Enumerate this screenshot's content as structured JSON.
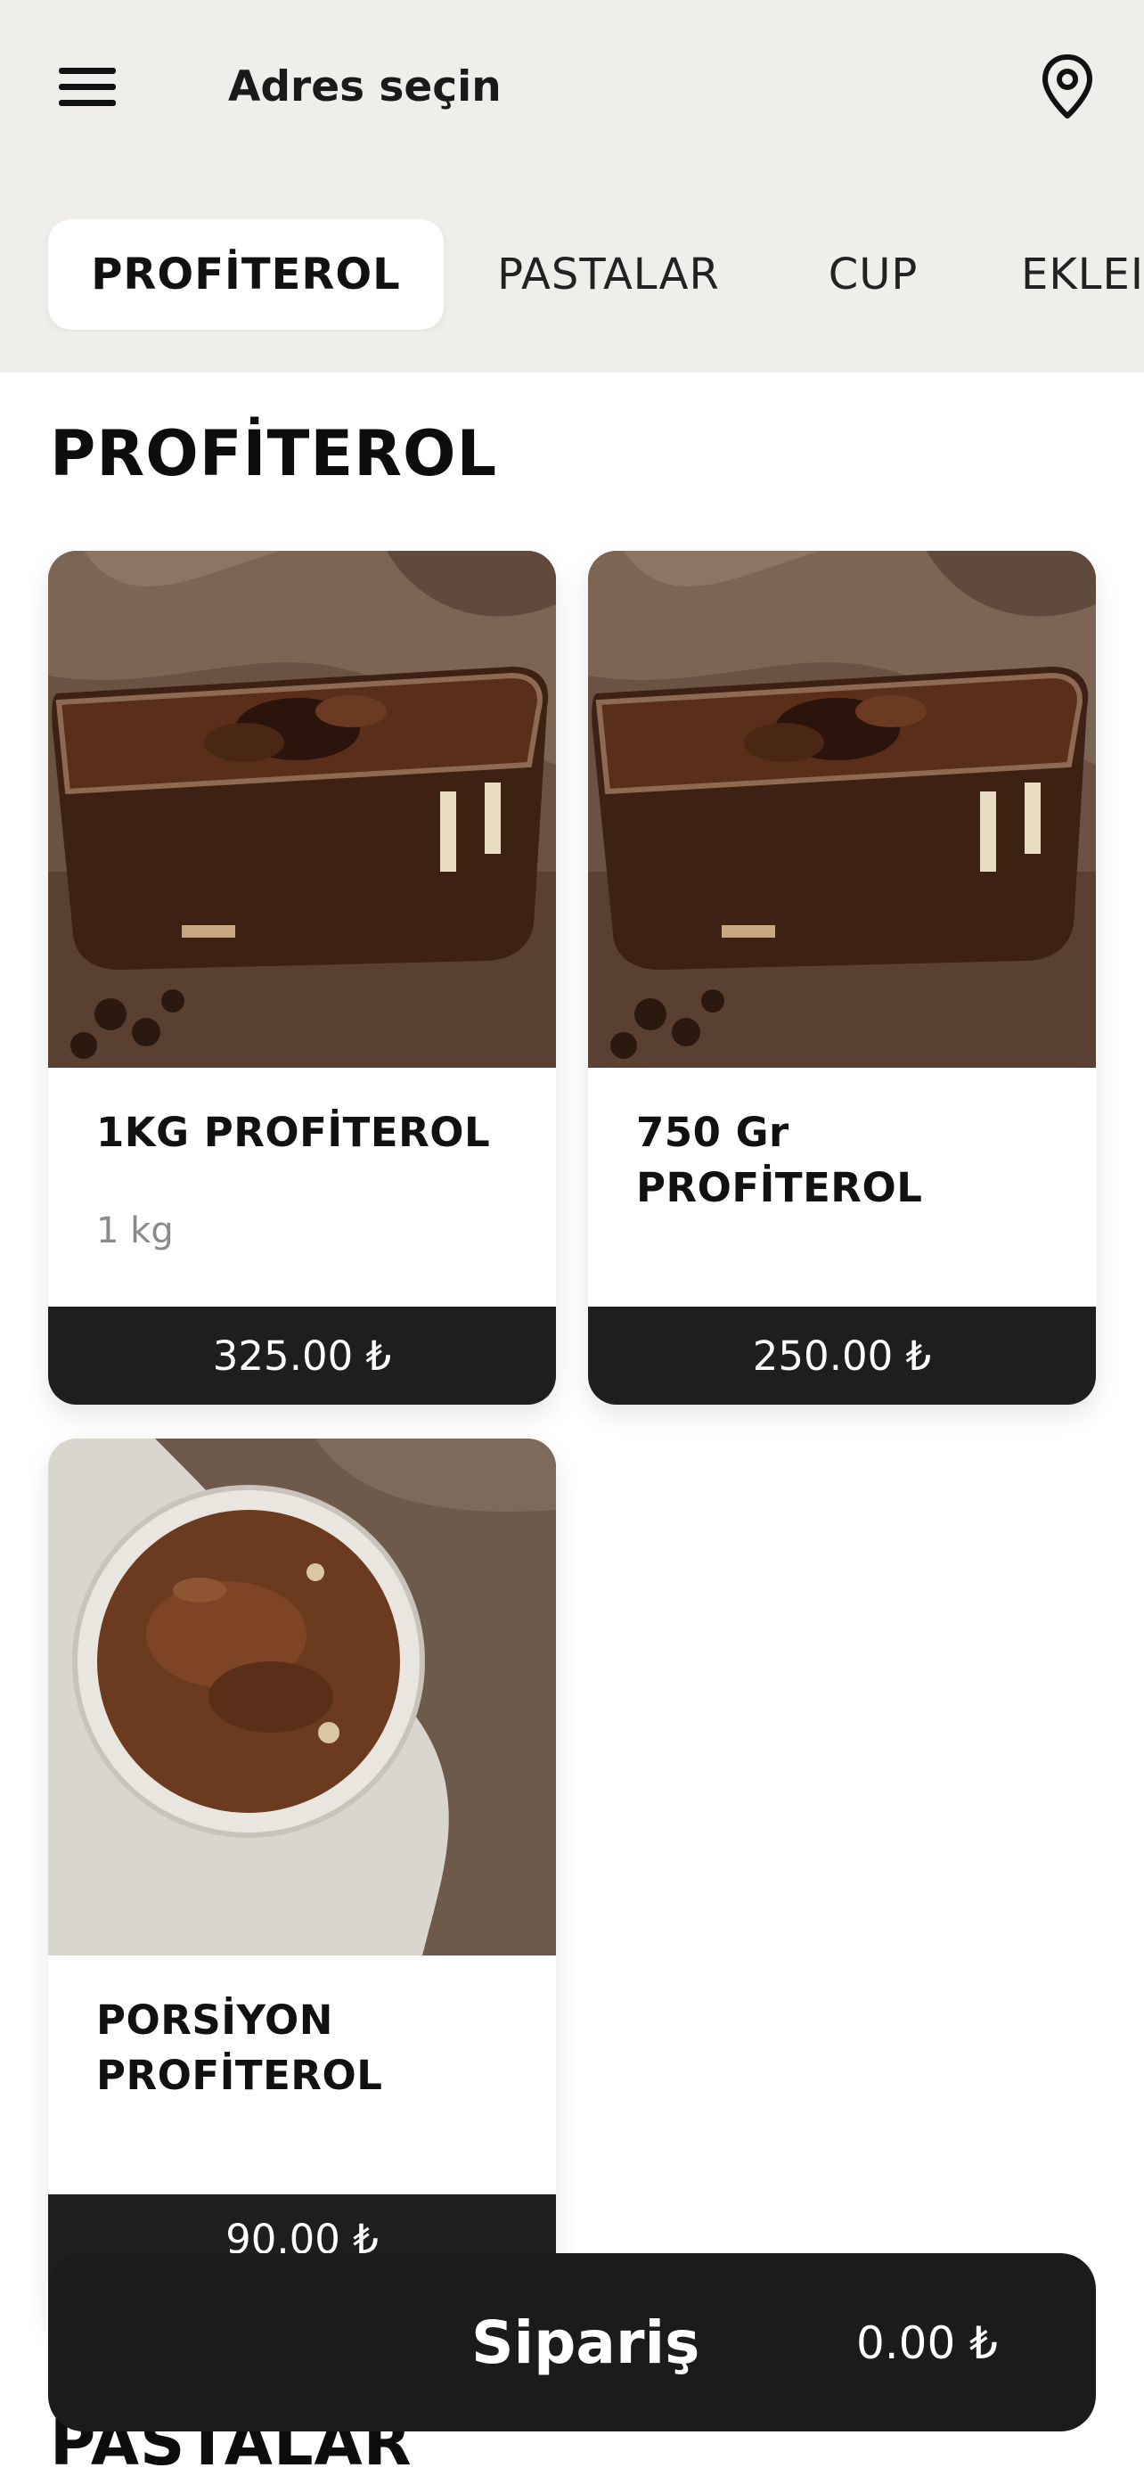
{
  "header": {
    "address_label": "Adres seçin"
  },
  "tabs": [
    {
      "label": "PROFİTEROL",
      "active": true
    },
    {
      "label": "PASTALAR",
      "active": false
    },
    {
      "label": "CUP",
      "active": false
    },
    {
      "label": "EKLEI",
      "active": false
    }
  ],
  "sections": {
    "profiterol_title": "PROFİTEROL",
    "pastalar_title": "PASTALAR"
  },
  "products": [
    {
      "name": "1KG PROFİTEROL",
      "subtitle": "1 kg",
      "price": "325.00 ₺"
    },
    {
      "name": "750 Gr PROFİTEROL",
      "subtitle": "",
      "price": "250.00 ₺"
    },
    {
      "name": "PORSİYON PROFİTEROL",
      "subtitle": "",
      "price": "90.00 ₺"
    }
  ],
  "order": {
    "label": "Sipariş",
    "total": "0.00 ₺"
  },
  "colors": {
    "topbar_bg": "#efeeeb",
    "dark": "#1e1e1e",
    "chocolate": "#5a2f1a"
  },
  "icons": [
    "menu-icon",
    "location-pin-icon"
  ]
}
